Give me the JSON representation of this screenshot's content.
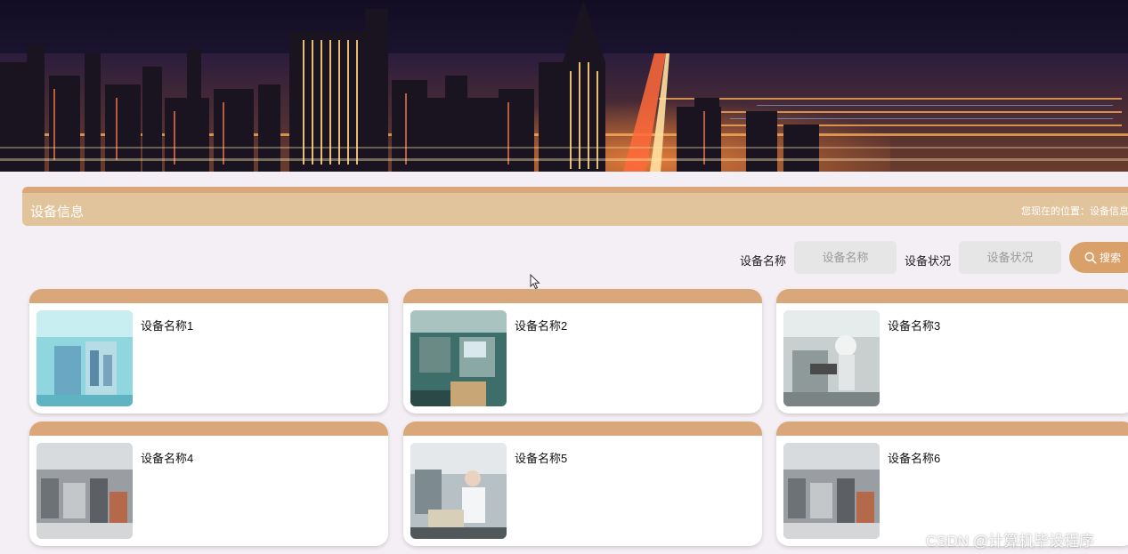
{
  "banner": {
    "image": "night-city-skyline-image"
  },
  "title_bar": {
    "title": "设备信息",
    "breadcrumb": "您现在的位置：设备信息"
  },
  "search": {
    "name_label": "设备名称",
    "name_placeholder": "设备名称",
    "status_label": "设备状况",
    "status_placeholder": "设备状况",
    "button_label": "搜索",
    "button_icon": "search-icon"
  },
  "cards": [
    {
      "name": "设备名称1",
      "image": "cleanroom-equipment-photo"
    },
    {
      "name": "设备名称2",
      "image": "production-line-photo"
    },
    {
      "name": "设备名称3",
      "image": "robot-arm-photo"
    },
    {
      "name": "设备名称4",
      "image": "factory-floor-photo"
    },
    {
      "name": "设备名称5",
      "image": "lab-worker-photo"
    },
    {
      "name": "设备名称6",
      "image": "factory-floor-photo"
    }
  ],
  "watermark": "CSDN @计算机毕设程序",
  "colors": {
    "page_bg": "#f4eff4",
    "title_bar": "#e1c49c",
    "accent": "#d9a77a",
    "search_button": "#d9a06a"
  }
}
